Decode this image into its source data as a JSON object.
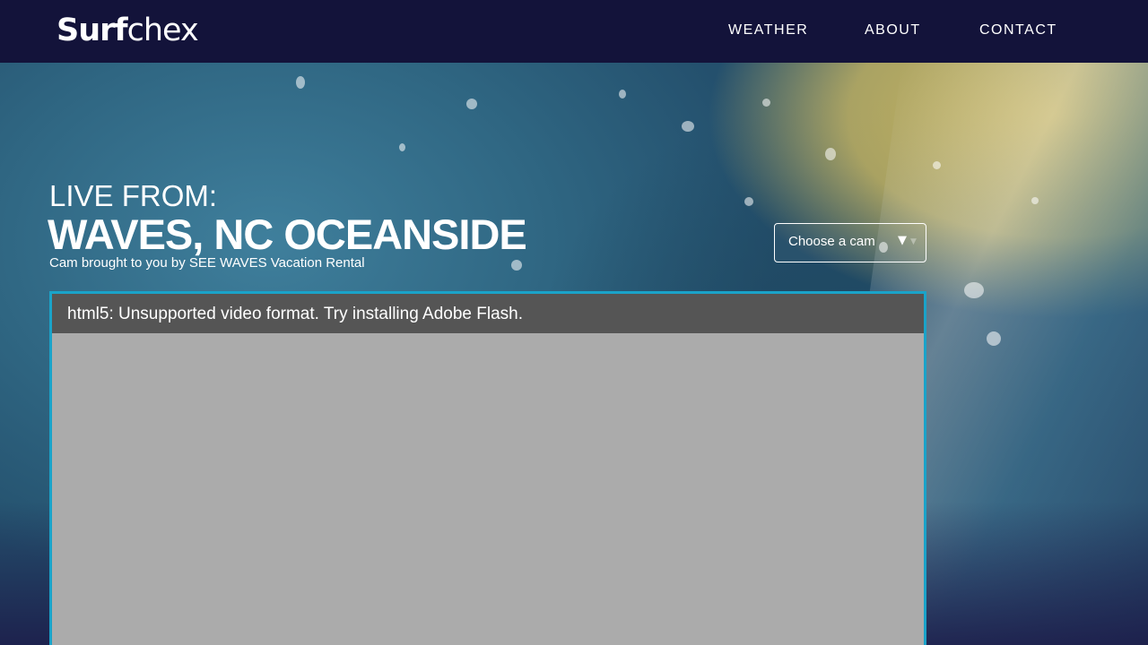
{
  "nav": {
    "logo": {
      "bold": "Surf",
      "light": "chex"
    },
    "links": [
      {
        "label": "WEATHER"
      },
      {
        "label": "ABOUT"
      },
      {
        "label": "CONTACT"
      }
    ]
  },
  "cam": {
    "live_label": "LIVE FROM:",
    "title": "WAVES, NC OCEANSIDE",
    "sponsor": "Cam brought to you by SEE WAVES Vacation Rental",
    "selector": {
      "placeholder": "Choose a cam",
      "arrow": "▼",
      "arrow_dim": "▼"
    }
  },
  "video": {
    "error_message": "html5: Unsupported video format. Try installing Adobe Flash."
  },
  "colors": {
    "nav_background": "#13133a",
    "video_border": "#1aa3c9",
    "video_error_bar": "#555555",
    "video_area": "#ababab"
  }
}
